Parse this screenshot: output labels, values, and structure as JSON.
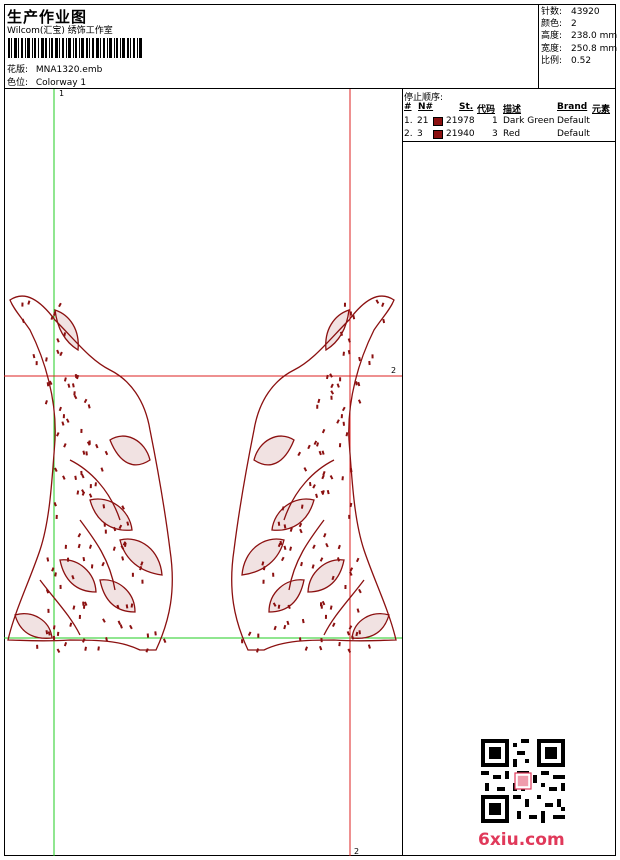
{
  "header": {
    "title": "生产作业图",
    "company": "Wilcom(汇宝) 绣饰工作室",
    "design_label": "花版:",
    "design_value": "MNA1320.emb",
    "colorway_label": "色位:",
    "colorway_value": "Colorway 1"
  },
  "stats": [
    {
      "label": "针数:",
      "value": "43920"
    },
    {
      "label": "颜色:",
      "value": "2"
    },
    {
      "label": "高度:",
      "value": "238.0 mm"
    },
    {
      "label": "宽度:",
      "value": "250.8 mm"
    },
    {
      "label": "比例:",
      "value": "0.52"
    }
  ],
  "stop_sequence": {
    "title": "停止顺序:",
    "columns": [
      "#",
      "N#",
      "St.",
      "代码",
      "描述",
      "Brand",
      "元素"
    ],
    "rows": [
      {
        "index": "1.",
        "n": "21",
        "color": "#8b1010",
        "stitches": "21978",
        "code": "1",
        "description": "Dark Green",
        "brand": "Default"
      },
      {
        "index": "2.",
        "n": "3",
        "color": "#8b1010",
        "stitches": "21940",
        "code": "3",
        "description": "Red",
        "brand": "Default"
      }
    ]
  },
  "guides": {
    "top_label": "1",
    "right_label": "2",
    "bottom_label": "2"
  },
  "colors": {
    "thread": "#8b1010",
    "guide_green": "#22cc22",
    "guide_red": "#dd2222",
    "watermark": "#e0395a"
  },
  "watermark": {
    "text": "6xiu.com"
  }
}
